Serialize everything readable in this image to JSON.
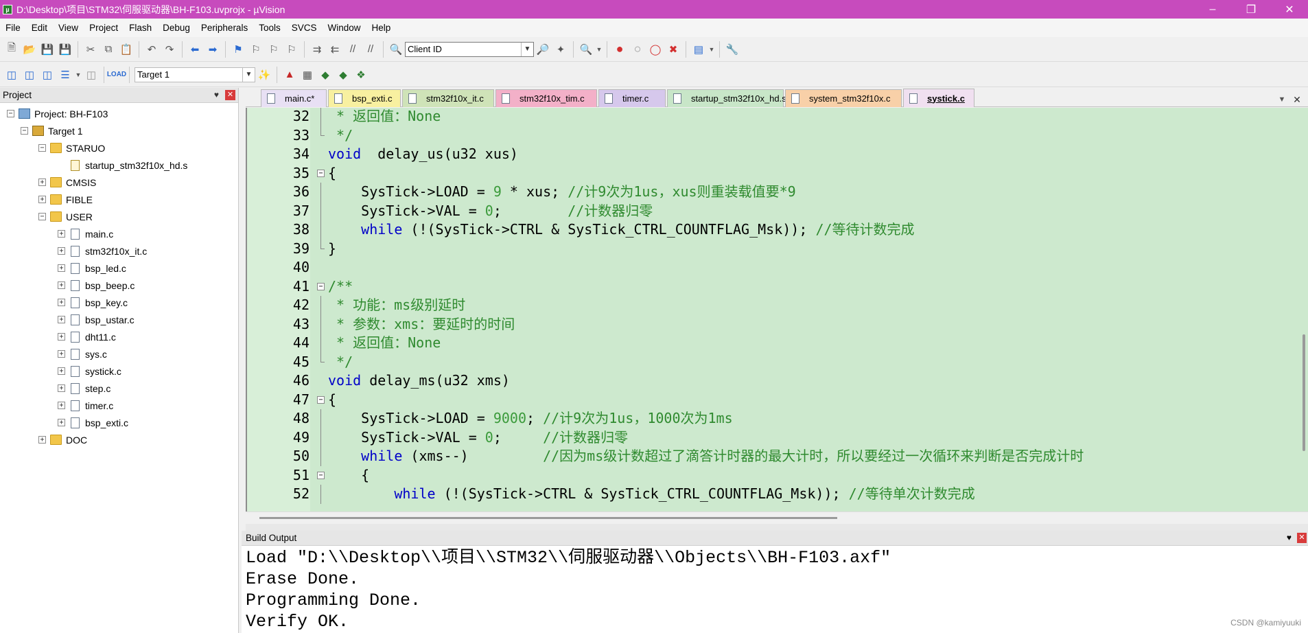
{
  "window": {
    "title": "D:\\Desktop\\项目\\STM32\\伺服驱动器\\BH-F103.uvprojx - µVision"
  },
  "menu": [
    "File",
    "Edit",
    "View",
    "Project",
    "Flash",
    "Debug",
    "Peripherals",
    "Tools",
    "SVCS",
    "Window",
    "Help"
  ],
  "toolbar": {
    "combo_value": "Client ID",
    "target_value": "Target 1"
  },
  "project_panel": {
    "title": "Project",
    "tree": [
      {
        "label": "Project: BH-F103",
        "level": 0,
        "exp": "−",
        "icon": "proj"
      },
      {
        "label": "Target 1",
        "level": 1,
        "exp": "−",
        "icon": "target"
      },
      {
        "label": "STARUO",
        "level": 2,
        "exp": "−",
        "icon": "folder"
      },
      {
        "label": "startup_stm32f10x_hd.s",
        "level": 3,
        "exp": "",
        "icon": "filegear"
      },
      {
        "label": "CMSIS",
        "level": 2,
        "exp": "+",
        "icon": "folder"
      },
      {
        "label": "FIBLE",
        "level": 2,
        "exp": "+",
        "icon": "folder"
      },
      {
        "label": "USER",
        "level": 2,
        "exp": "−",
        "icon": "folder"
      },
      {
        "label": "main.c",
        "level": 3,
        "exp": "+",
        "icon": "file"
      },
      {
        "label": "stm32f10x_it.c",
        "level": 3,
        "exp": "+",
        "icon": "file"
      },
      {
        "label": "bsp_led.c",
        "level": 3,
        "exp": "+",
        "icon": "file"
      },
      {
        "label": "bsp_beep.c",
        "level": 3,
        "exp": "+",
        "icon": "file"
      },
      {
        "label": "bsp_key.c",
        "level": 3,
        "exp": "+",
        "icon": "file"
      },
      {
        "label": "bsp_ustar.c",
        "level": 3,
        "exp": "+",
        "icon": "file"
      },
      {
        "label": "dht11.c",
        "level": 3,
        "exp": "+",
        "icon": "file"
      },
      {
        "label": "sys.c",
        "level": 3,
        "exp": "+",
        "icon": "file"
      },
      {
        "label": "systick.c",
        "level": 3,
        "exp": "+",
        "icon": "file"
      },
      {
        "label": "step.c",
        "level": 3,
        "exp": "+",
        "icon": "file"
      },
      {
        "label": "timer.c",
        "level": 3,
        "exp": "+",
        "icon": "file"
      },
      {
        "label": "bsp_exti.c",
        "level": 3,
        "exp": "+",
        "icon": "file"
      },
      {
        "label": "DOC",
        "level": 2,
        "exp": "+",
        "icon": "folder"
      }
    ]
  },
  "tabs": [
    {
      "label": "main.c*",
      "color": "#e8e0f4"
    },
    {
      "label": "bsp_exti.c",
      "color": "#f8f0a0"
    },
    {
      "label": "stm32f10x_it.c",
      "color": "#cfe3b8"
    },
    {
      "label": "stm32f10x_tim.c",
      "color": "#f3b0c8"
    },
    {
      "label": "timer.c",
      "color": "#d6c8ec"
    },
    {
      "label": "startup_stm32f10x_hd.s",
      "color": "#c8e6c8"
    },
    {
      "label": "system_stm32f10x.c",
      "color": "#f8d0a8"
    },
    {
      "label": "systick.c",
      "color": "#f0e0f0",
      "active": true
    }
  ],
  "code": [
    {
      "n": "32",
      "fold": "line",
      "parts": [
        [
          "cm",
          " * 返回值：None"
        ]
      ]
    },
    {
      "n": "33",
      "fold": "end",
      "parts": [
        [
          "cm",
          " */"
        ]
      ]
    },
    {
      "n": "34",
      "fold": "",
      "parts": [
        [
          "kw",
          "void"
        ],
        [
          "",
          "  delay_us(u32 xus)"
        ]
      ]
    },
    {
      "n": "35",
      "fold": "box",
      "parts": [
        [
          "",
          "{"
        ]
      ]
    },
    {
      "n": "36",
      "fold": "line",
      "parts": [
        [
          "",
          "    SysTick->LOAD = "
        ],
        [
          "num",
          "9"
        ],
        [
          "",
          " * xus; "
        ],
        [
          "cm",
          "//计9次为1us，xus则重装载值要*9"
        ]
      ]
    },
    {
      "n": "37",
      "fold": "line",
      "parts": [
        [
          "",
          "    SysTick->VAL = "
        ],
        [
          "num",
          "0"
        ],
        [
          "",
          ";        "
        ],
        [
          "cm",
          "//计数器归零"
        ]
      ]
    },
    {
      "n": "38",
      "fold": "line",
      "parts": [
        [
          "kw",
          "    while"
        ],
        [
          "",
          " (!(SysTick->CTRL & SysTick_CTRL_COUNTFLAG_Msk)); "
        ],
        [
          "cm",
          "//等待计数完成"
        ]
      ]
    },
    {
      "n": "39",
      "fold": "end",
      "parts": [
        [
          "",
          "}"
        ]
      ]
    },
    {
      "n": "40",
      "fold": "",
      "parts": [
        [
          "",
          ""
        ]
      ]
    },
    {
      "n": "41",
      "fold": "box",
      "parts": [
        [
          "cm",
          "/**"
        ]
      ]
    },
    {
      "n": "42",
      "fold": "line",
      "parts": [
        [
          "cm",
          " * 功能：ms级别延时"
        ]
      ]
    },
    {
      "n": "43",
      "fold": "line",
      "parts": [
        [
          "cm",
          " * 参数：xms：要延时的时间"
        ]
      ]
    },
    {
      "n": "44",
      "fold": "line",
      "parts": [
        [
          "cm",
          " * 返回值：None"
        ]
      ]
    },
    {
      "n": "45",
      "fold": "end",
      "parts": [
        [
          "cm",
          " */"
        ]
      ]
    },
    {
      "n": "46",
      "fold": "",
      "parts": [
        [
          "kw",
          "void"
        ],
        [
          "",
          " delay_ms(u32 xms)"
        ]
      ]
    },
    {
      "n": "47",
      "fold": "box",
      "parts": [
        [
          "",
          "{"
        ]
      ]
    },
    {
      "n": "48",
      "fold": "line",
      "parts": [
        [
          "",
          "    SysTick->LOAD = "
        ],
        [
          "num",
          "9000"
        ],
        [
          "",
          "; "
        ],
        [
          "cm",
          "//计9次为1us，1000次为1ms"
        ]
      ]
    },
    {
      "n": "49",
      "fold": "line",
      "parts": [
        [
          "",
          "    SysTick->VAL = "
        ],
        [
          "num",
          "0"
        ],
        [
          "",
          ";     "
        ],
        [
          "cm",
          "//计数器归零"
        ]
      ]
    },
    {
      "n": "50",
      "fold": "line",
      "parts": [
        [
          "kw",
          "    while"
        ],
        [
          "",
          " (xms--)         "
        ],
        [
          "cm",
          "//因为ms级计数超过了滴答计时器的最大计时，所以要经过一次循环来判断是否完成计时"
        ]
      ]
    },
    {
      "n": "51",
      "fold": "box",
      "parts": [
        [
          "",
          "    {"
        ]
      ]
    },
    {
      "n": "52",
      "fold": "line",
      "parts": [
        [
          "kw",
          "        while"
        ],
        [
          "",
          " (!(SysTick->CTRL & SysTick_CTRL_COUNTFLAG_Msk)); "
        ],
        [
          "cm",
          "//等待单次计数完成"
        ]
      ]
    }
  ],
  "build_output": {
    "title": "Build Output",
    "lines": [
      "Load \"D:\\\\Desktop\\\\项目\\\\STM32\\\\伺服驱动器\\\\Objects\\\\BH-F103.axf\"",
      "Erase Done.",
      "Programming Done.",
      "Verify OK."
    ]
  },
  "watermark": "CSDN @kamiyuuki"
}
